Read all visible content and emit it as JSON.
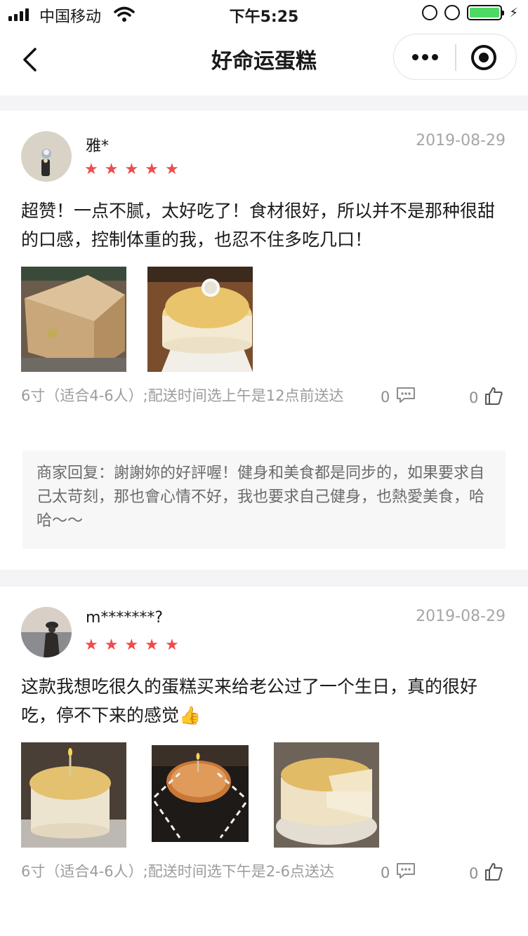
{
  "status_bar": {
    "carrier": "中国移动",
    "time": "下午5:25"
  },
  "nav": {
    "title": "好命运蛋糕"
  },
  "reviews": [
    {
      "user": "雅*",
      "date": "2019-08-29",
      "rating": 5,
      "text": "超赞！一点不腻，太好吃了！食材很好，所以并不是那种很甜的口感，控制体重的我，也忍不住多吃几口！",
      "spec": "6寸（适合4-6人）;配送时间选上午是12点前送达",
      "comments": "0",
      "likes": "0",
      "reply": "商家回复：謝謝妳的好評喔！健身和美食都是同步的，如果要求自己太苛刻，那也會心情不好，我也要求自己健身，也熱愛美食，哈哈～～"
    },
    {
      "user": "m*******?",
      "date": "2019-08-29",
      "rating": 5,
      "text": "这款我想吃很久的蛋糕买来给老公过了一个生日，真的很好吃，停不下来的感觉👍",
      "spec": "6寸（适合4-6人）;配送时间选下午是2-6点送达",
      "comments": "0",
      "likes": "0"
    }
  ],
  "colors": {
    "star": "#ef4b4b",
    "battery": "#4cd964",
    "date": "#a6a6a6"
  }
}
